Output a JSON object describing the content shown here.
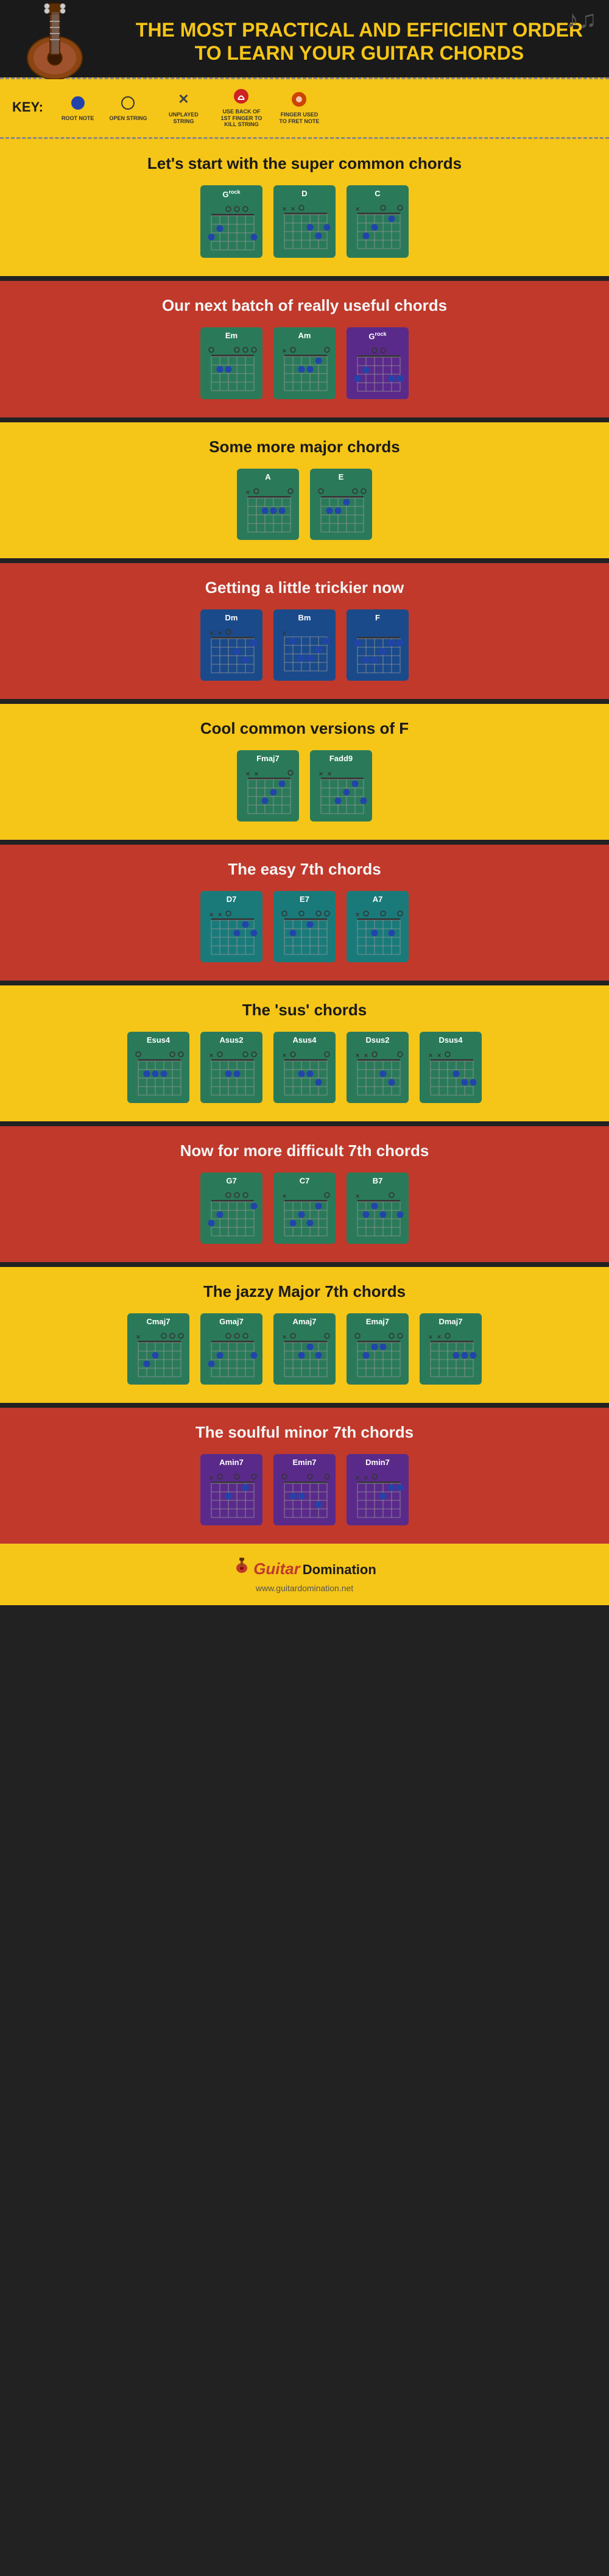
{
  "header": {
    "title": "THE MOST PRACTICAL AND EFFICIENT ORDER TO LEARN YOUR GUITAR CHORDS",
    "guitar_icon": "guitar",
    "music_notes": "♪ ♫"
  },
  "key": {
    "label": "KEY:",
    "items": [
      {
        "symbol": "filled-circle",
        "desc": "ROOT NOTE"
      },
      {
        "symbol": "open-circle",
        "desc": "OPEN STRING"
      },
      {
        "symbol": "X",
        "desc": "UNPLAYED STRING"
      },
      {
        "symbol": "back-finger",
        "desc": "USE BACK OF 1ST FINGER TO KILL STRING"
      },
      {
        "symbol": "fret-note",
        "desc": "FINGER USED TO FRET NOTE"
      }
    ]
  },
  "sections": [
    {
      "id": "super-common",
      "bg": "yellow",
      "title": "Let's start with the super common chords",
      "chords": [
        {
          "name": "G",
          "sup": "rock",
          "color": "green",
          "notes": "320003"
        },
        {
          "name": "D",
          "sup": "",
          "color": "green",
          "notes": "xx0232"
        },
        {
          "name": "C",
          "sup": "",
          "color": "green",
          "notes": "x32010"
        }
      ]
    },
    {
      "id": "really-useful",
      "bg": "red",
      "title": "Our next batch of really useful chords",
      "chords": [
        {
          "name": "Em",
          "sup": "",
          "color": "green",
          "notes": "022000"
        },
        {
          "name": "Am",
          "sup": "",
          "color": "green",
          "notes": "x02210"
        },
        {
          "name": "G",
          "sup": "rock",
          "color": "purple",
          "notes": "320033"
        }
      ]
    },
    {
      "id": "major-chords",
      "bg": "yellow",
      "title": "Some more major chords",
      "chords": [
        {
          "name": "A",
          "sup": "",
          "color": "green",
          "notes": "x02220"
        },
        {
          "name": "E",
          "sup": "",
          "color": "green",
          "notes": "022100"
        }
      ]
    },
    {
      "id": "trickier",
      "bg": "red",
      "title": "Getting a little trickier now",
      "chords": [
        {
          "name": "Dm",
          "sup": "",
          "color": "blue",
          "notes": "xx0231"
        },
        {
          "name": "Bm",
          "sup": "",
          "color": "blue",
          "notes": "x24432"
        },
        {
          "name": "F",
          "sup": "",
          "color": "blue",
          "notes": "133211"
        }
      ]
    },
    {
      "id": "cool-f",
      "bg": "yellow",
      "title": "Cool common versions of F",
      "chords": [
        {
          "name": "Fmaj7",
          "sup": "",
          "color": "green",
          "notes": "xx3210"
        },
        {
          "name": "Fadd9",
          "sup": "",
          "color": "green",
          "notes": "xx3213"
        }
      ]
    },
    {
      "id": "easy-7th",
      "bg": "red",
      "title": "The easy 7th chords",
      "chords": [
        {
          "name": "D7",
          "sup": "",
          "color": "teal",
          "notes": "xx0212"
        },
        {
          "name": "E7",
          "sup": "",
          "color": "teal",
          "notes": "020100"
        },
        {
          "name": "A7",
          "sup": "",
          "color": "teal",
          "notes": "x02020"
        }
      ]
    },
    {
      "id": "sus-chords",
      "bg": "yellow",
      "title": "The 'sus' chords",
      "chords": [
        {
          "name": "Esus4",
          "sup": "",
          "color": "green",
          "notes": "022200"
        },
        {
          "name": "Asus2",
          "sup": "",
          "color": "green",
          "notes": "x02200"
        },
        {
          "name": "Asus4",
          "sup": "",
          "color": "green",
          "notes": "x02230"
        },
        {
          "name": "Dsus2",
          "sup": "",
          "color": "green",
          "notes": "xx0230"
        },
        {
          "name": "Dsus4",
          "sup": "",
          "color": "green",
          "notes": "xx0233"
        }
      ]
    },
    {
      "id": "difficult-7th",
      "bg": "red",
      "title": "Now for more difficult 7th chords",
      "chords": [
        {
          "name": "G7",
          "sup": "",
          "color": "green",
          "notes": "320001"
        },
        {
          "name": "C7",
          "sup": "",
          "color": "green",
          "notes": "x32310"
        },
        {
          "name": "B7",
          "sup": "",
          "color": "green",
          "notes": "x21202"
        }
      ]
    },
    {
      "id": "jazzy-maj7",
      "bg": "yellow",
      "title": "The jazzy Major 7th chords",
      "chords": [
        {
          "name": "Cmaj7",
          "sup": "",
          "color": "green",
          "notes": "x32000"
        },
        {
          "name": "Gmaj7",
          "sup": "",
          "color": "green",
          "notes": "320002"
        },
        {
          "name": "Amaj7",
          "sup": "",
          "color": "green",
          "notes": "x02120"
        },
        {
          "name": "Emaj7",
          "sup": "",
          "color": "green",
          "notes": "021100"
        },
        {
          "name": "Dmaj7",
          "sup": "",
          "color": "green",
          "notes": "xx0222"
        }
      ]
    },
    {
      "id": "soulful-min7",
      "bg": "red",
      "title": "The soulful minor 7th chords",
      "chords": [
        {
          "name": "Amin7",
          "sup": "",
          "color": "purple",
          "notes": "x02010"
        },
        {
          "name": "Emin7",
          "sup": "",
          "color": "purple",
          "notes": "022030"
        },
        {
          "name": "Dmin7",
          "sup": "",
          "color": "purple",
          "notes": "xx0211"
        }
      ]
    }
  ],
  "footer": {
    "logo_guitar": "Guitar",
    "logo_domination": "Domination",
    "url": "www.guitardomination.net"
  }
}
